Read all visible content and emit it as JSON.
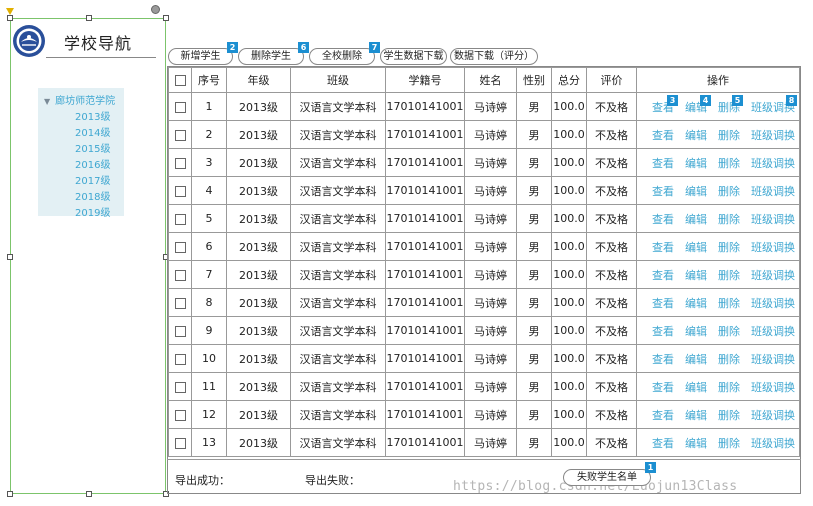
{
  "nav": {
    "title": "学校导航",
    "tree": {
      "root": "廊坊师范学院",
      "items": [
        "2013级",
        "2014级",
        "2015级",
        "2016级",
        "2017级",
        "2018级",
        "2019级"
      ]
    }
  },
  "toolbar": {
    "add": "新增学生",
    "add_badge": "2",
    "delete": "删除学生",
    "delete_badge": "6",
    "delete_all": "全校删除",
    "delete_all_badge": "7",
    "download_students": "学生数据下载",
    "download_data": "数据下载（评分）"
  },
  "table": {
    "headers": [
      "序号",
      "年级",
      "班级",
      "学籍号",
      "姓名",
      "性别",
      "总分",
      "评价",
      "操作"
    ],
    "ops": [
      "查看",
      "编辑",
      "删除",
      "班级调换"
    ],
    "op_badges": [
      "3",
      "4",
      "5",
      "8"
    ],
    "rows": [
      {
        "no": "1",
        "grade": "2013级",
        "class": "汉语言文学本科",
        "id": "17010141001",
        "name": "马诗婷",
        "gender": "男",
        "total": "100.0",
        "eval": "不及格"
      },
      {
        "no": "2",
        "grade": "2013级",
        "class": "汉语言文学本科",
        "id": "17010141001",
        "name": "马诗婷",
        "gender": "男",
        "total": "100.0",
        "eval": "不及格"
      },
      {
        "no": "3",
        "grade": "2013级",
        "class": "汉语言文学本科",
        "id": "17010141001",
        "name": "马诗婷",
        "gender": "男",
        "total": "100.0",
        "eval": "不及格"
      },
      {
        "no": "4",
        "grade": "2013级",
        "class": "汉语言文学本科",
        "id": "17010141001",
        "name": "马诗婷",
        "gender": "男",
        "total": "100.0",
        "eval": "不及格"
      },
      {
        "no": "5",
        "grade": "2013级",
        "class": "汉语言文学本科",
        "id": "17010141001",
        "name": "马诗婷",
        "gender": "男",
        "total": "100.0",
        "eval": "不及格"
      },
      {
        "no": "6",
        "grade": "2013级",
        "class": "汉语言文学本科",
        "id": "17010141001",
        "name": "马诗婷",
        "gender": "男",
        "total": "100.0",
        "eval": "不及格"
      },
      {
        "no": "7",
        "grade": "2013级",
        "class": "汉语言文学本科",
        "id": "17010141001",
        "name": "马诗婷",
        "gender": "男",
        "total": "100.0",
        "eval": "不及格"
      },
      {
        "no": "8",
        "grade": "2013级",
        "class": "汉语言文学本科",
        "id": "17010141001",
        "name": "马诗婷",
        "gender": "男",
        "total": "100.0",
        "eval": "不及格"
      },
      {
        "no": "9",
        "grade": "2013级",
        "class": "汉语言文学本科",
        "id": "17010141001",
        "name": "马诗婷",
        "gender": "男",
        "total": "100.0",
        "eval": "不及格"
      },
      {
        "no": "10",
        "grade": "2013级",
        "class": "汉语言文学本科",
        "id": "17010141001",
        "name": "马诗婷",
        "gender": "男",
        "total": "100.0",
        "eval": "不及格"
      },
      {
        "no": "11",
        "grade": "2013级",
        "class": "汉语言文学本科",
        "id": "17010141001",
        "name": "马诗婷",
        "gender": "男",
        "total": "100.0",
        "eval": "不及格"
      },
      {
        "no": "12",
        "grade": "2013级",
        "class": "汉语言文学本科",
        "id": "17010141001",
        "name": "马诗婷",
        "gender": "男",
        "total": "100.0",
        "eval": "不及格"
      },
      {
        "no": "13",
        "grade": "2013级",
        "class": "汉语言文学本科",
        "id": "17010141001",
        "name": "马诗婷",
        "gender": "男",
        "total": "100.0",
        "eval": "不及格"
      }
    ]
  },
  "footer": {
    "export_success": "导出成功：",
    "export_fail": "导出失败：",
    "fail_list": "失败学生名单",
    "fail_list_badge": "1"
  },
  "watermark": "https://blog.csdn.net/Luojun13Class",
  "colors": {
    "link": "#3fa7d1",
    "badge": "#1c8fd1",
    "selection": "#7cc46b",
    "tree_bg": "#e3f0f4"
  }
}
